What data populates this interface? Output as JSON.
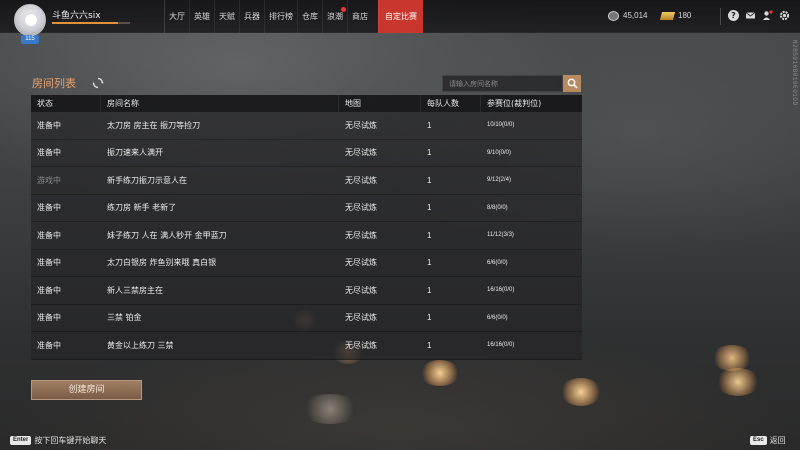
{
  "player": {
    "name": "斗鱼六六six",
    "level": "115",
    "xp_fraction": 0.85
  },
  "nav": {
    "items": [
      {
        "label": "大厅"
      },
      {
        "label": "英雄"
      },
      {
        "label": "天赋"
      },
      {
        "label": "兵器"
      },
      {
        "label": "排行榜"
      },
      {
        "label": "仓库"
      },
      {
        "label": "浪潮",
        "badge": true
      },
      {
        "label": "商店"
      }
    ],
    "active_label": "自定比赛"
  },
  "currency": {
    "coins": "45,014",
    "gold": "180"
  },
  "top_icons": [
    "help-icon",
    "mail-icon",
    "friends-icon",
    "settings-icon"
  ],
  "side_text": "N2B5916B010E01OD",
  "panel": {
    "title": "房间列表",
    "search_placeholder": "请输入房间名称"
  },
  "table": {
    "headers": [
      "状态",
      "房间名称",
      "地图",
      "每队人数",
      "参赛位(裁判位)"
    ],
    "rows": [
      {
        "status": "准备中",
        "name": "太刀房 房主在 振刀等捡刀",
        "map": "无尽试炼",
        "per_team": "1",
        "slots": "10/10(0/0)",
        "dim": false
      },
      {
        "status": "准备中",
        "name": "振刀速来人满开",
        "map": "无尽试炼",
        "per_team": "1",
        "slots": "9/10(0/0)",
        "dim": false
      },
      {
        "status": "游戏中",
        "name": "新手练刀振刀示意人在",
        "map": "无尽试炼",
        "per_team": "1",
        "slots": "9/12(2/4)",
        "dim": true
      },
      {
        "status": "准备中",
        "name": "练刀房  新手  老新了",
        "map": "无尽试炼",
        "per_team": "1",
        "slots": "8/8(0/0)",
        "dim": false
      },
      {
        "status": "准备中",
        "name": "妹子练刀 人在 满人秒开 金甲蓝刀",
        "map": "无尽试炼",
        "per_team": "1",
        "slots": "11/12(3/3)",
        "dim": false
      },
      {
        "status": "准备中",
        "name": "太刀白银房 炸鱼别来哦 真白银",
        "map": "无尽试炼",
        "per_team": "1",
        "slots": "6/6(0/0)",
        "dim": false
      },
      {
        "status": "准备中",
        "name": "新人三禁房主在",
        "map": "无尽试炼",
        "per_team": "1",
        "slots": "16/16(0/0)",
        "dim": false
      },
      {
        "status": "准备中",
        "name": "三禁 铂金",
        "map": "无尽试炼",
        "per_team": "1",
        "slots": "6/6(0/0)",
        "dim": false
      },
      {
        "status": "准备中",
        "name": "黄金以上练刀 三禁",
        "map": "无尽试炼",
        "per_team": "1",
        "slots": "16/16(0/0)",
        "dim": false
      }
    ]
  },
  "actions": {
    "create_room": "创建房间"
  },
  "footer": {
    "chat_key": "Enter",
    "chat_hint": "按下回车键开始聊天",
    "back_key": "Esc",
    "back_label": "返回"
  }
}
